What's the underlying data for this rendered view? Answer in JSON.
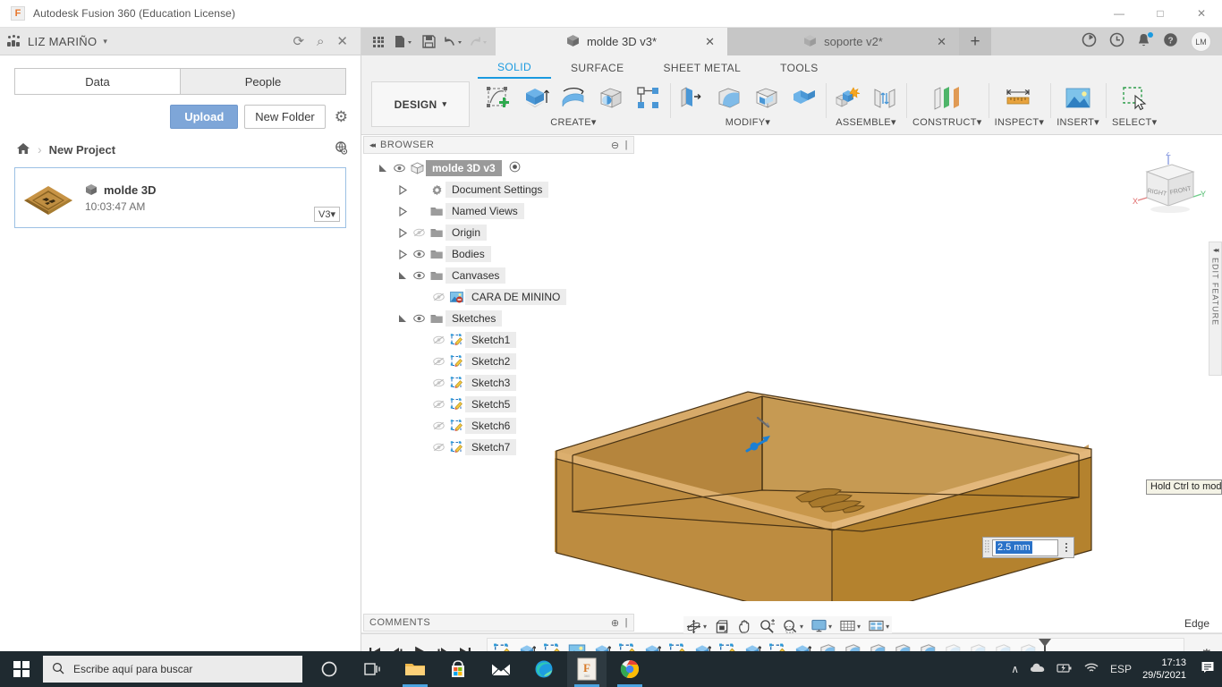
{
  "window": {
    "title": "Autodesk Fusion 360 (Education License)",
    "logo_letter": "F",
    "minimize": "—",
    "maximize": "□",
    "close": "✕"
  },
  "data_panel": {
    "user": "LIZ MARIÑO",
    "user_caret": "▾",
    "refresh_icon": "⟳",
    "search_icon": "⌕",
    "close_icon": "✕",
    "tabs": [
      {
        "label": "Data",
        "active": true
      },
      {
        "label": "People",
        "active": false
      }
    ],
    "upload_label": "Upload",
    "new_folder_label": "New Folder",
    "settings_icon": "⚙",
    "breadcrumb": {
      "home_icon": "⌂",
      "separator": "›",
      "project": "New Project",
      "globe_icon": "⊕"
    },
    "file": {
      "name": "molde 3D",
      "time": "10:03:47 AM",
      "version": "V3",
      "version_caret": "▾"
    }
  },
  "tabstrip": {
    "quick_access": [
      "apps-grid-icon",
      "new-file-icon",
      "save-icon",
      "undo-icon",
      "redo-icon"
    ],
    "documents": [
      {
        "label": "molde 3D v3*",
        "active": true,
        "close": "✕"
      },
      {
        "label": "soporte v2*",
        "active": false,
        "close": "✕"
      }
    ],
    "new_tab": "+",
    "right_icons": [
      "job-status-icon",
      "history-icon",
      "notifications-icon",
      "help-icon"
    ],
    "avatar_initials": "LM"
  },
  "ribbon": {
    "tabs": [
      {
        "label": "SOLID",
        "active": true
      },
      {
        "label": "SURFACE",
        "active": false
      },
      {
        "label": "SHEET METAL",
        "active": false
      },
      {
        "label": "TOOLS",
        "active": false
      }
    ],
    "workspace": "DESIGN",
    "workspace_caret": "▾",
    "groups": [
      {
        "label": "CREATE",
        "caret": "▾",
        "icons": [
          "create-sketch-icon",
          "extrude-icon",
          "revolve-icon",
          "sphere-icon",
          "pattern-icon"
        ]
      },
      {
        "label": "MODIFY",
        "caret": "▾",
        "icons": [
          "press-pull-icon",
          "fillet-icon",
          "shell-icon",
          "combine-icon"
        ]
      },
      {
        "label": "ASSEMBLE",
        "caret": "▾",
        "icons": [
          "new-component-icon",
          "joint-icon"
        ]
      },
      {
        "label": "CONSTRUCT",
        "caret": "▾",
        "icons": [
          "offset-plane-icon"
        ]
      },
      {
        "label": "INSPECT",
        "caret": "▾",
        "icons": [
          "measure-icon"
        ]
      },
      {
        "label": "INSERT",
        "caret": "▾",
        "icons": [
          "insert-canvas-icon"
        ]
      },
      {
        "label": "SELECT",
        "caret": "▾",
        "icons": [
          "select-window-icon"
        ]
      }
    ]
  },
  "browser": {
    "title": "BROWSER",
    "collapse_icon": "◂◂",
    "minimize_icon": "⊖",
    "tree": [
      {
        "label": "molde 3D v3",
        "indent": 0,
        "expander": "expanded",
        "eye": "on",
        "icon": "component-icon",
        "root": true,
        "trailing": "radio-icon"
      },
      {
        "label": "Document Settings",
        "indent": 1,
        "expander": "collapsed",
        "eye": "none",
        "icon": "gear-icon"
      },
      {
        "label": "Named Views",
        "indent": 1,
        "expander": "collapsed",
        "eye": "none",
        "icon": "folder-icon"
      },
      {
        "label": "Origin",
        "indent": 1,
        "expander": "collapsed",
        "eye": "off",
        "icon": "folder-icon"
      },
      {
        "label": "Bodies",
        "indent": 1,
        "expander": "collapsed",
        "eye": "on",
        "icon": "folder-icon"
      },
      {
        "label": "Canvases",
        "indent": 1,
        "expander": "expanded",
        "eye": "on",
        "icon": "folder-icon"
      },
      {
        "label": "CARA DE MININO",
        "indent": 2,
        "expander": "none",
        "eye": "off",
        "icon": "canvas-image-icon"
      },
      {
        "label": "Sketches",
        "indent": 1,
        "expander": "expanded",
        "eye": "on",
        "icon": "folder-icon"
      },
      {
        "label": "Sketch1",
        "indent": 2,
        "expander": "none",
        "eye": "off",
        "icon": "sketch-icon"
      },
      {
        "label": "Sketch2",
        "indent": 2,
        "expander": "none",
        "eye": "off",
        "icon": "sketch-icon"
      },
      {
        "label": "Sketch3",
        "indent": 2,
        "expander": "none",
        "eye": "off",
        "icon": "sketch-icon"
      },
      {
        "label": "Sketch5",
        "indent": 2,
        "expander": "none",
        "eye": "off",
        "icon": "sketch-icon"
      },
      {
        "label": "Sketch6",
        "indent": 2,
        "expander": "none",
        "eye": "off",
        "icon": "sketch-icon"
      },
      {
        "label": "Sketch7",
        "indent": 2,
        "expander": "none",
        "eye": "off",
        "icon": "sketch-icon"
      }
    ]
  },
  "viewport": {
    "viewcube": {
      "face_left": "RIGHT",
      "face_right": "FRONT",
      "axis_x": "X",
      "axis_y": "Y",
      "axis_z": "Z"
    },
    "edit_feature_panel": {
      "label": "EDIT FEATURE",
      "collapse_icon": "◂◂"
    },
    "dimension_input": {
      "value": "2.5 mm",
      "menu_icon": "⋮"
    },
    "tooltip": "Hold Ctrl to modif",
    "model_color": "#b98236"
  },
  "bottom_bar": {
    "comments_label": "COMMENTS",
    "comments_add_icon": "⊕",
    "nav_tools": [
      "orbit-icon",
      "look-at-icon",
      "pan-icon",
      "zoom-icon",
      "zoom-window-icon",
      "display-settings-icon",
      "grid-snaps-icon",
      "viewports-icon"
    ],
    "status": "Edge"
  },
  "timeline": {
    "playback": [
      "go-to-beginning-icon",
      "step-back-icon",
      "play-icon",
      "step-forward-icon",
      "go-to-end-icon"
    ],
    "features": [
      "sketch-icon",
      "extrude-icon",
      "sketch-icon",
      "canvas-icon",
      "extrude-icon",
      "sketch-icon",
      "extrude-icon",
      "sketch-icon",
      "extrude-icon",
      "sketch-icon",
      "extrude-icon",
      "sketch-icon",
      "extrude-icon",
      "fillet-icon",
      "fillet-icon",
      "fillet-icon",
      "fillet-icon",
      "fillet-icon",
      "fillet-pending-icon",
      "fillet-pending-icon",
      "fillet-pending-icon",
      "fillet-pending-icon"
    ],
    "settings_icon": "⚙"
  },
  "taskbar": {
    "search_placeholder": "Escribe aquí para buscar",
    "search_icon": "⌕",
    "apps": [
      "cortana-icon",
      "task-view-icon",
      "file-explorer-icon",
      "microsoft-store-icon",
      "mail-icon",
      "edge-icon",
      "fusion360-icon",
      "chrome-icon"
    ],
    "tray": {
      "chevron": "∧",
      "cloud": "☁",
      "battery": "▮",
      "wifi": "◠",
      "language": "ESP"
    },
    "time": "17:13",
    "date": "29/5/2021",
    "notification_icon": "☰"
  }
}
